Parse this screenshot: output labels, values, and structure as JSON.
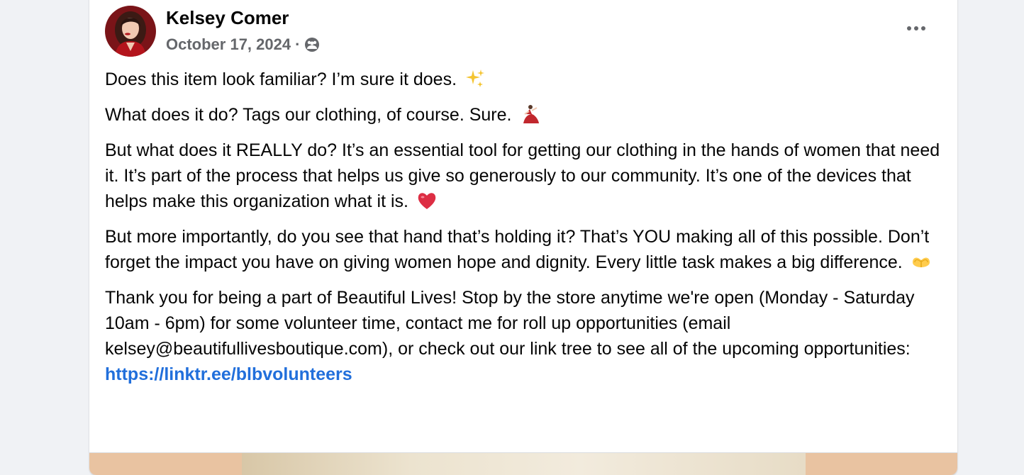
{
  "post": {
    "author": "Kelsey Comer",
    "date": "October 17, 2024",
    "separator": "·",
    "audience_icon": "group-audience-icon",
    "more_icon": "more-options-icon",
    "paragraphs": [
      {
        "text": "Does this item look familiar? I’m sure it does.",
        "emoji": "sparkles-emoji"
      },
      {
        "text": "What does it do? Tags our clothing, of course. Sure.",
        "emoji": "dancer-emoji"
      },
      {
        "text": "But what does it REALLY do? It’s an essential tool for getting our clothing in the hands of women that need it. It’s part of the process that helps us give so generously to our community. It’s one of the devices that helps make this organization what it is.",
        "emoji": "red-heart-emoji"
      },
      {
        "text": "But more importantly, do you see that hand that’s holding it? That’s YOU making all of this possible. Don’t forget the impact you have on giving women hope and dignity. Every little task makes a big difference.",
        "emoji": "heart-hands-emoji"
      },
      {
        "text": "Thank you for being a part of Beautiful Lives! Stop by the store anytime we're open (Monday - Saturday 10am - 6pm) for some volunteer time, contact me for roll up opportunities (email kelsey@beautifullivesboutique.com), or check out our link tree to see all of the upcoming opportunities:"
      }
    ],
    "link": "https://linktr.ee/blbvolunteers"
  },
  "colors": {
    "page_background": "#f0f2f5",
    "card_background": "#ffffff",
    "text_primary": "#050505",
    "text_secondary": "#65676b",
    "link": "#216fdb"
  }
}
